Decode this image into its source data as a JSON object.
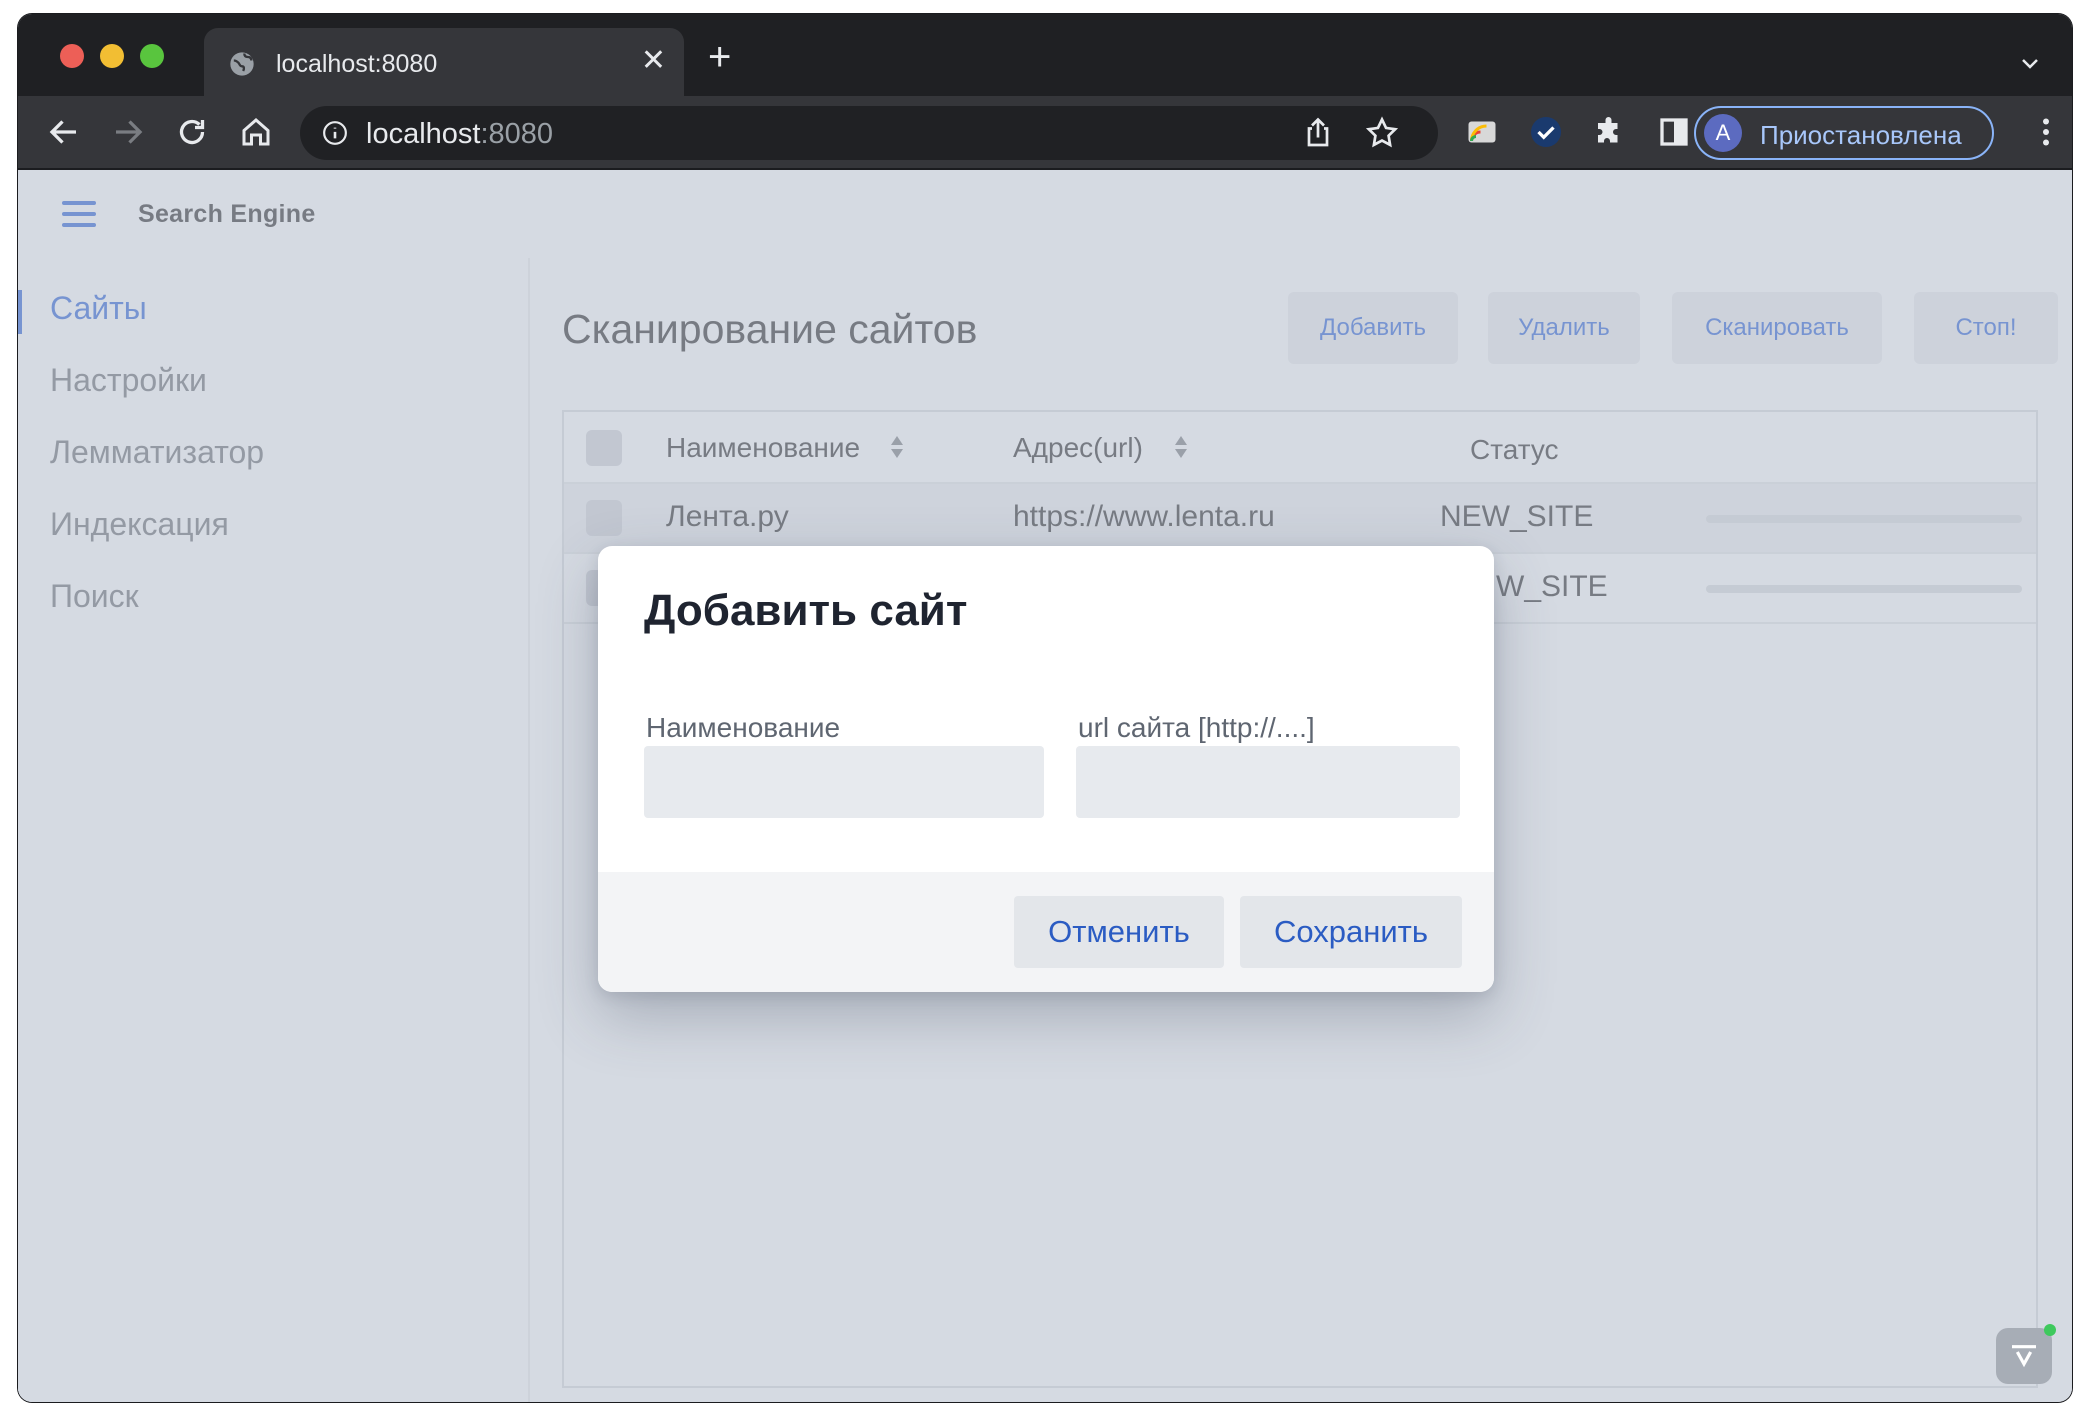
{
  "browser": {
    "tab_title": "localhost:8080",
    "close_glyph": "✕",
    "new_tab_glyph": "+",
    "url_host": "localhost",
    "url_port": ":8080",
    "profile_initial": "A",
    "profile_label": "Приостановлена"
  },
  "app": {
    "title": "Search Engine"
  },
  "sidebar": {
    "items": [
      {
        "label": "Сайты",
        "active": true
      },
      {
        "label": "Настройки",
        "active": false
      },
      {
        "label": "Лемматизатор",
        "active": false
      },
      {
        "label": "Индексация",
        "active": false
      },
      {
        "label": "Поиск",
        "active": false
      }
    ]
  },
  "main": {
    "title": "Сканирование сайтов",
    "buttons": {
      "add": "Добавить",
      "delete": "Удалить",
      "scan": "Сканировать",
      "stop": "Стоп!"
    },
    "table": {
      "headers": {
        "name": "Наименование",
        "url": "Адрес(url)",
        "status": "Статус"
      },
      "rows": [
        {
          "name": "Лента.ру",
          "url": "https://www.lenta.ru",
          "status": "NEW_SITE"
        },
        {
          "name": "",
          "url": "",
          "status": "W_SITE"
        }
      ]
    }
  },
  "modal": {
    "title": "Добавить сайт",
    "name_label": "Наименование",
    "url_label": "url сайта [http://....]",
    "name_value": "",
    "url_value": "",
    "cancel": "Отменить",
    "save": "Сохранить"
  },
  "colors": {
    "accent": "#2b5cc3",
    "background": "#d5dae2"
  }
}
